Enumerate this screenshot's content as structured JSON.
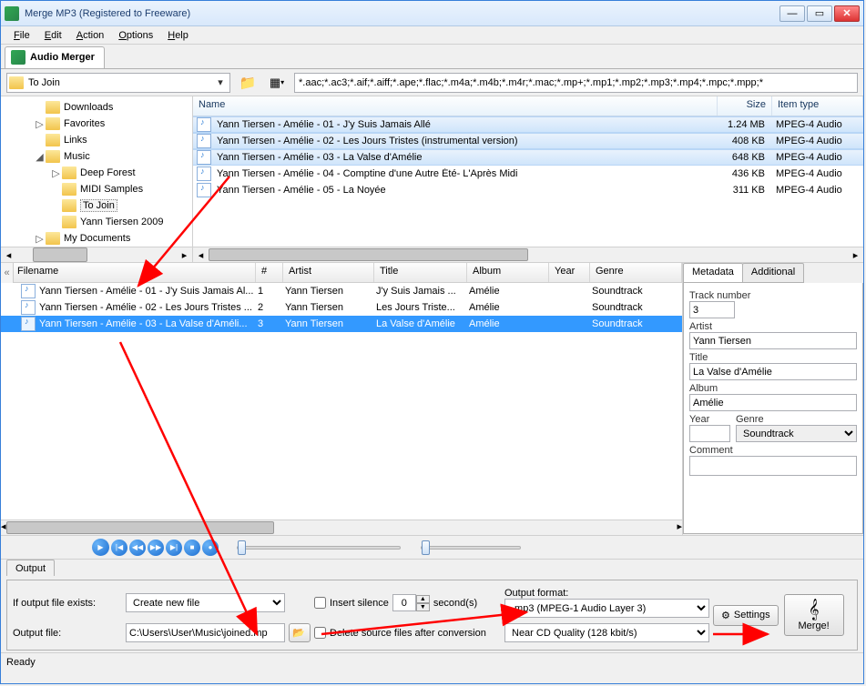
{
  "window_title": "Merge MP3 (Registered to Freeware)",
  "menubar": [
    "File",
    "Edit",
    "Action",
    "Options",
    "Help"
  ],
  "main_tab": "Audio Merger",
  "folder_dropdown": "To Join",
  "file_filter": "*.aac;*.ac3;*.aif;*.aiff;*.ape;*.flac;*.m4a;*.m4b;*.m4r;*.mac;*.mp+;*.mp1;*.mp2;*.mp3;*.mp4;*.mpc;*.mpp;*",
  "tree": [
    {
      "indent": 1,
      "exp": "",
      "label": "Downloads"
    },
    {
      "indent": 1,
      "exp": "▷",
      "label": "Favorites"
    },
    {
      "indent": 1,
      "exp": "",
      "label": "Links"
    },
    {
      "indent": 1,
      "exp": "◢",
      "label": "Music"
    },
    {
      "indent": 2,
      "exp": "▷",
      "label": "Deep Forest"
    },
    {
      "indent": 2,
      "exp": "",
      "label": "MIDI Samples"
    },
    {
      "indent": 2,
      "exp": "",
      "label": "To Join",
      "sel": true
    },
    {
      "indent": 2,
      "exp": "",
      "label": "Yann Tiersen 2009"
    },
    {
      "indent": 1,
      "exp": "▷",
      "label": "My Documents"
    }
  ],
  "file_columns": {
    "name": "Name",
    "size": "Size",
    "type": "Item type"
  },
  "files": [
    {
      "name": "Yann Tiersen - Amélie - 01 - J'y Suis Jamais Allé",
      "size": "1.24 MB",
      "type": "MPEG-4 Audio",
      "sel": true
    },
    {
      "name": "Yann Tiersen - Amélie - 02 - Les Jours Tristes (instrumental version)",
      "size": "408 KB",
      "type": "MPEG-4 Audio",
      "sel": true
    },
    {
      "name": "Yann Tiersen - Amélie - 03 - La Valse d'Amélie",
      "size": "648 KB",
      "type": "MPEG-4 Audio",
      "sel": true
    },
    {
      "name": "Yann Tiersen - Amélie - 04 - Comptine d'une Autre Été- L'Après Midi",
      "size": "436 KB",
      "type": "MPEG-4 Audio",
      "sel": false
    },
    {
      "name": "Yann Tiersen - Amélie - 05 - La Noyée",
      "size": "311 KB",
      "type": "MPEG-4 Audio",
      "sel": false
    }
  ],
  "queue_columns": [
    "Filename",
    "#",
    "Artist",
    "Title",
    "Album",
    "Year",
    "Genre"
  ],
  "queue": [
    {
      "filename": "Yann Tiersen - Amélie - 01 - J'y Suis Jamais Al...",
      "num": "1",
      "artist": "Yann Tiersen",
      "title": "J'y Suis Jamais ...",
      "album": "Amélie",
      "year": "",
      "genre": "Soundtrack",
      "sel": false
    },
    {
      "filename": "Yann Tiersen - Amélie - 02 - Les Jours Tristes ...",
      "num": "2",
      "artist": "Yann Tiersen",
      "title": "Les Jours Triste...",
      "album": "Amélie",
      "year": "",
      "genre": "Soundtrack",
      "sel": false
    },
    {
      "filename": "Yann Tiersen - Amélie - 03 - La Valse d'Améli...",
      "num": "3",
      "artist": "Yann Tiersen",
      "title": "La Valse d'Amélie",
      "album": "Amélie",
      "year": "",
      "genre": "Soundtrack",
      "sel": true
    }
  ],
  "meta_tabs": [
    "Metadata",
    "Additional"
  ],
  "metadata": {
    "track_number_label": "Track number",
    "track_number": "3",
    "artist_label": "Artist",
    "artist": "Yann Tiersen",
    "title_label": "Title",
    "title": "La Valse d'Amélie",
    "album_label": "Album",
    "album": "Amélie",
    "year_label": "Year",
    "year": "",
    "genre_label": "Genre",
    "genre": "Soundtrack",
    "comment_label": "Comment",
    "comment": ""
  },
  "output": {
    "tab": "Output",
    "exists_label": "If output file exists:",
    "exists_value": "Create new file",
    "output_file_label": "Output file:",
    "output_file_value": "C:\\Users\\User\\Music\\joined.mp",
    "insert_silence_label": "Insert silence",
    "silence_value": "0",
    "seconds_label": "second(s)",
    "delete_src_label": "Delete source files after conversion",
    "format_label": "Output format:",
    "format_value": ".mp3 (MPEG-1 Audio Layer 3)",
    "quality_value": "Near CD Quality (128 kbit/s)",
    "settings_label": "Settings",
    "merge_label": "Merge!"
  },
  "status": "Ready"
}
